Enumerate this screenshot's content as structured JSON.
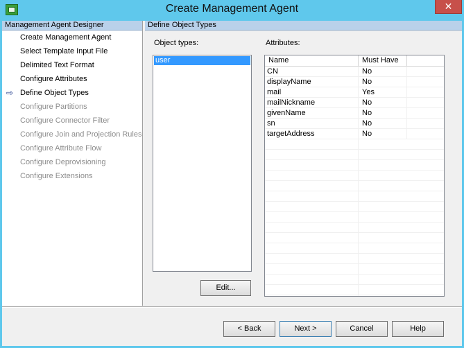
{
  "window": {
    "title": "Create Management Agent",
    "close_glyph": "✕"
  },
  "sidebar": {
    "header": "Management Agent Designer",
    "steps": [
      {
        "label": "Create Management Agent",
        "state": "enabled"
      },
      {
        "label": "Select Template Input File",
        "state": "enabled"
      },
      {
        "label": "Delimited Text Format",
        "state": "enabled"
      },
      {
        "label": "Configure Attributes",
        "state": "enabled"
      },
      {
        "label": "Define Object Types",
        "state": "current"
      },
      {
        "label": "Configure Partitions",
        "state": "disabled"
      },
      {
        "label": "Configure Connector Filter",
        "state": "disabled"
      },
      {
        "label": "Configure Join and Projection Rules",
        "state": "disabled"
      },
      {
        "label": "Configure Attribute Flow",
        "state": "disabled"
      },
      {
        "label": "Configure Deprovisioning",
        "state": "disabled"
      },
      {
        "label": "Configure Extensions",
        "state": "disabled"
      }
    ],
    "current_arrow": "⇨"
  },
  "main": {
    "header": "Define Object Types",
    "object_types_label": "Object types:",
    "object_types": [
      "user"
    ],
    "attributes_label": "Attributes:",
    "attr_columns": [
      "Name",
      "Must Have"
    ],
    "attributes": [
      {
        "name": "CN",
        "must": "No"
      },
      {
        "name": "displayName",
        "must": "No"
      },
      {
        "name": "mail",
        "must": "Yes"
      },
      {
        "name": "mailNickname",
        "must": "No"
      },
      {
        "name": "givenName",
        "must": "No"
      },
      {
        "name": "sn",
        "must": "No"
      },
      {
        "name": "targetAddress",
        "must": "No"
      }
    ],
    "edit_label": "Edit..."
  },
  "footer": {
    "back_label": "< Back",
    "next_label": "Next >",
    "cancel_label": "Cancel",
    "help_label": "Help"
  },
  "colors": {
    "title_bar": "#5fc8ec",
    "section_header": "#b9d1ea",
    "selection": "#3399ff",
    "close": "#c7504a"
  }
}
